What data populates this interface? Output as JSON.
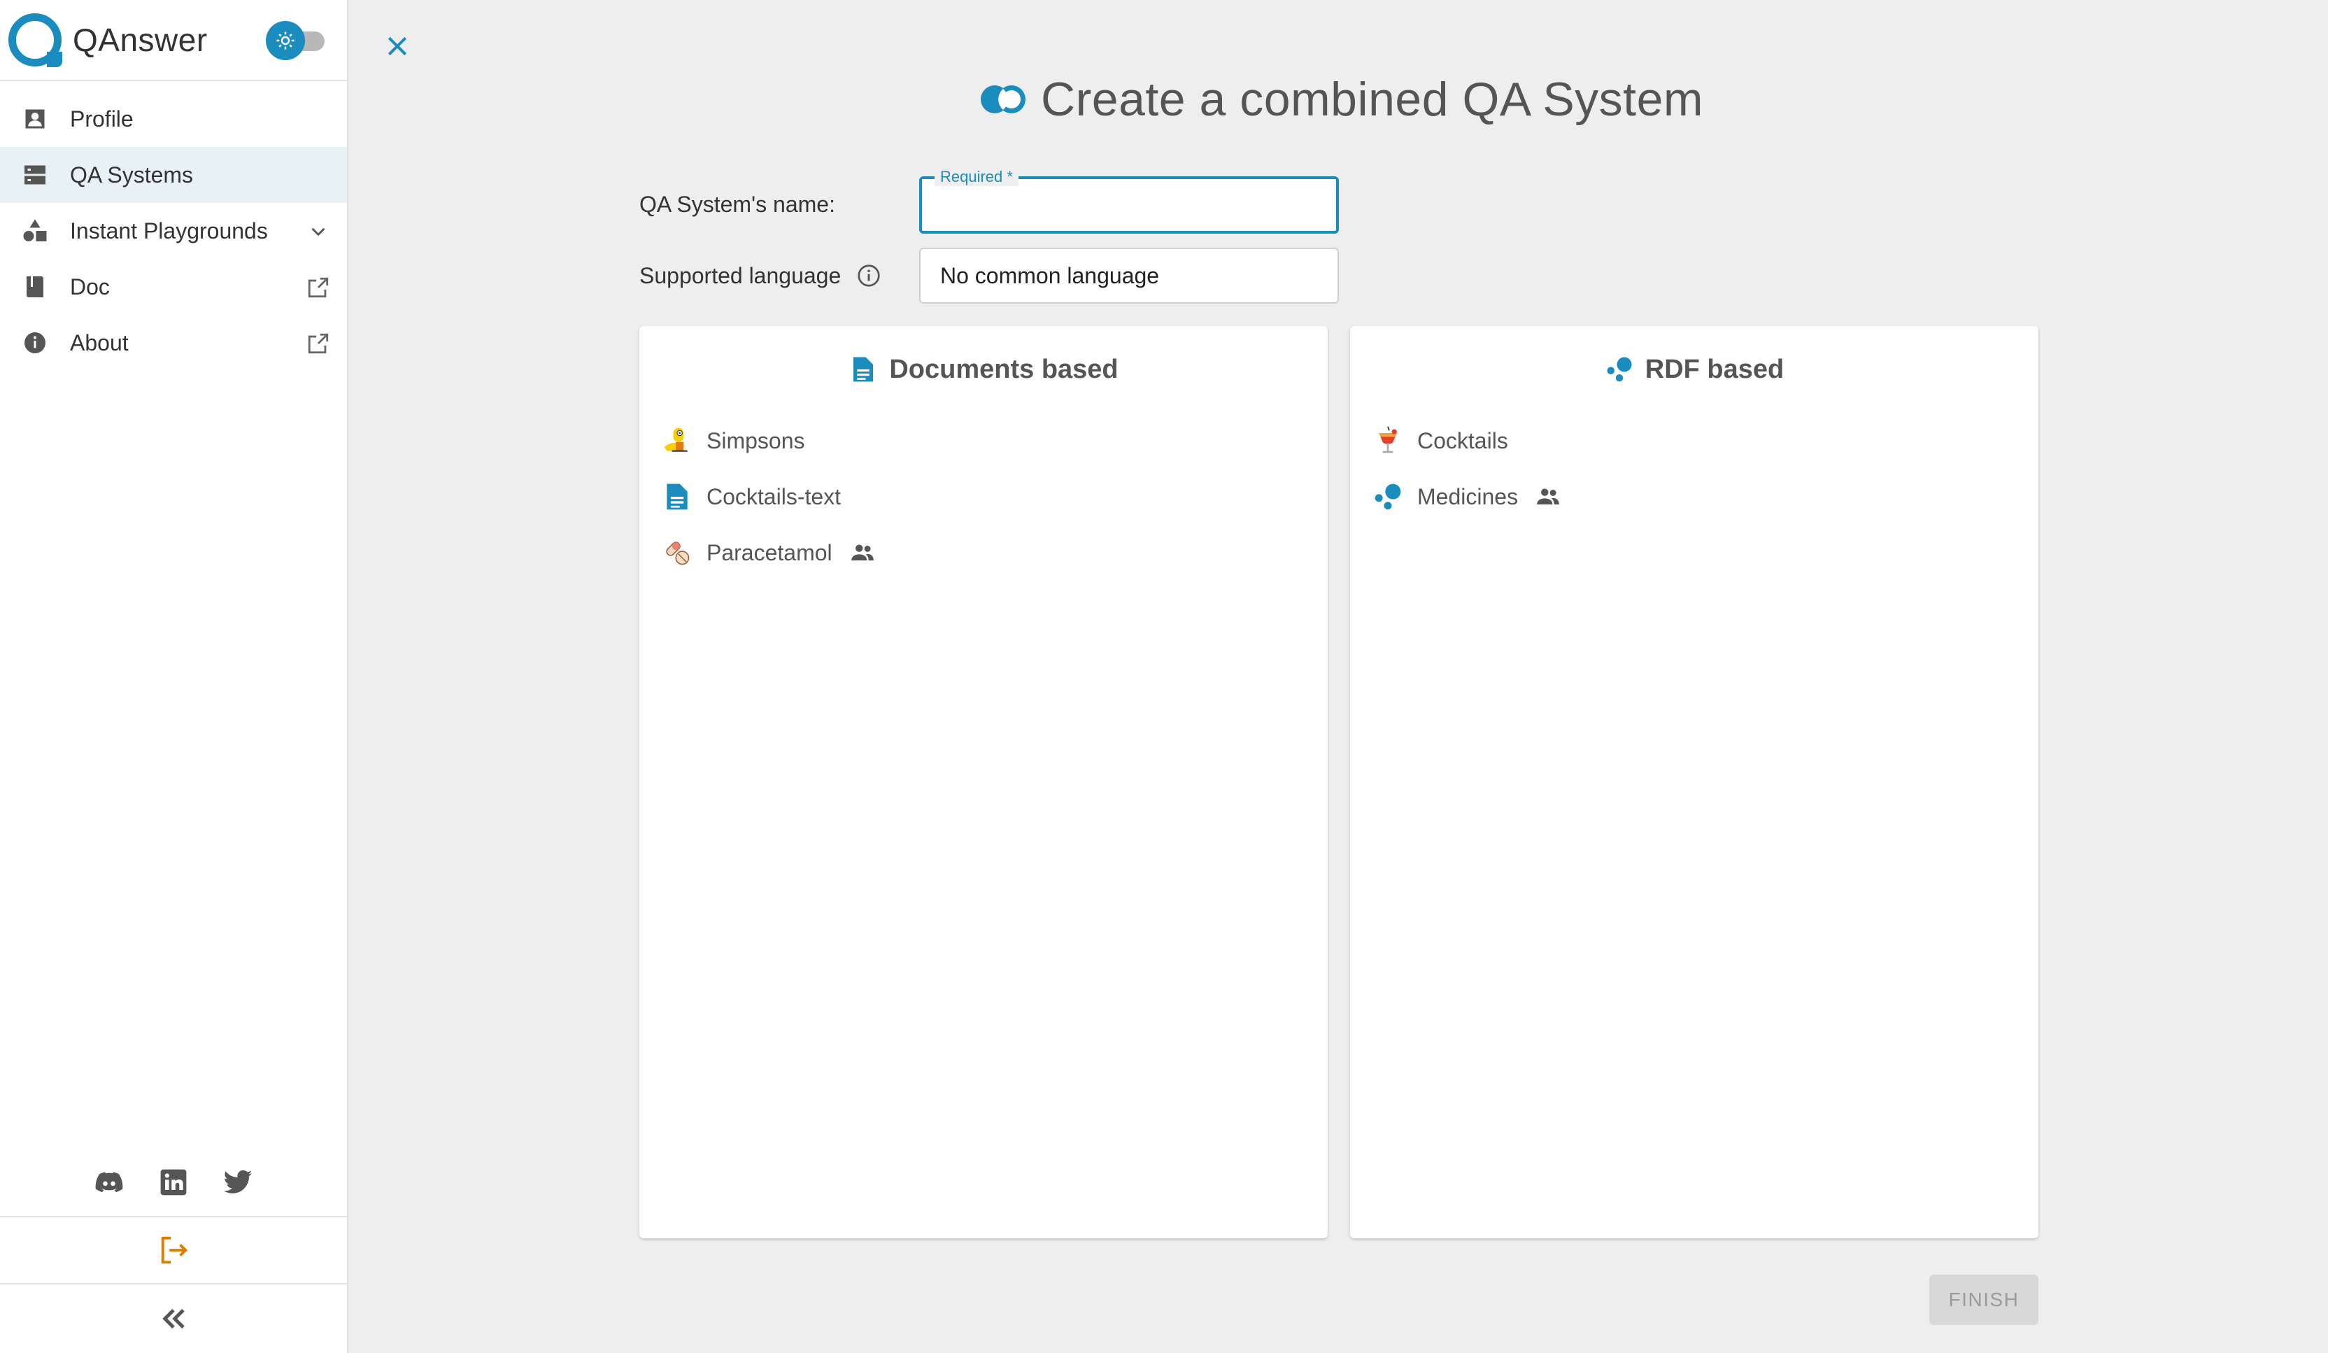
{
  "app": {
    "name": "QAnswer",
    "theme_toggle_icon": "sun-icon",
    "accent_color": "#1a8cbd"
  },
  "sidebar": {
    "items": [
      {
        "label": "Profile",
        "icon": "profile-icon"
      },
      {
        "label": "QA Systems",
        "icon": "qa-systems-icon",
        "active": true
      },
      {
        "label": "Instant Playgrounds",
        "icon": "shapes-icon",
        "right_icon": "chevron-down-icon"
      },
      {
        "label": "Doc",
        "icon": "book-icon",
        "right_icon": "external-link-icon"
      },
      {
        "label": "About",
        "icon": "info-icon",
        "right_icon": "external-link-icon"
      }
    ],
    "social": [
      "discord-icon",
      "linkedin-icon",
      "twitter-icon"
    ],
    "logout_icon": "logout-icon",
    "collapse_icon": "double-chevron-left-icon"
  },
  "main": {
    "title": "Create a combined QA System",
    "name_label": "QA System's name:",
    "name_legend": "Required *",
    "name_value": "",
    "language_label": "Supported language",
    "language_value": "No common language",
    "finish_label": "FINISH"
  },
  "panels": {
    "documents": {
      "title": "Documents based",
      "items": [
        {
          "label": "Simpsons",
          "icon": "simpsons-icon",
          "shared": false
        },
        {
          "label": "Cocktails-text",
          "icon": "document-icon",
          "shared": false
        },
        {
          "label": "Paracetamol",
          "icon": "pills-icon",
          "shared": true
        }
      ]
    },
    "rdf": {
      "title": "RDF based",
      "items": [
        {
          "label": "Cocktails",
          "icon": "cocktail-icon",
          "shared": false
        },
        {
          "label": "Medicines",
          "icon": "rdf-icon",
          "shared": true
        }
      ]
    }
  }
}
